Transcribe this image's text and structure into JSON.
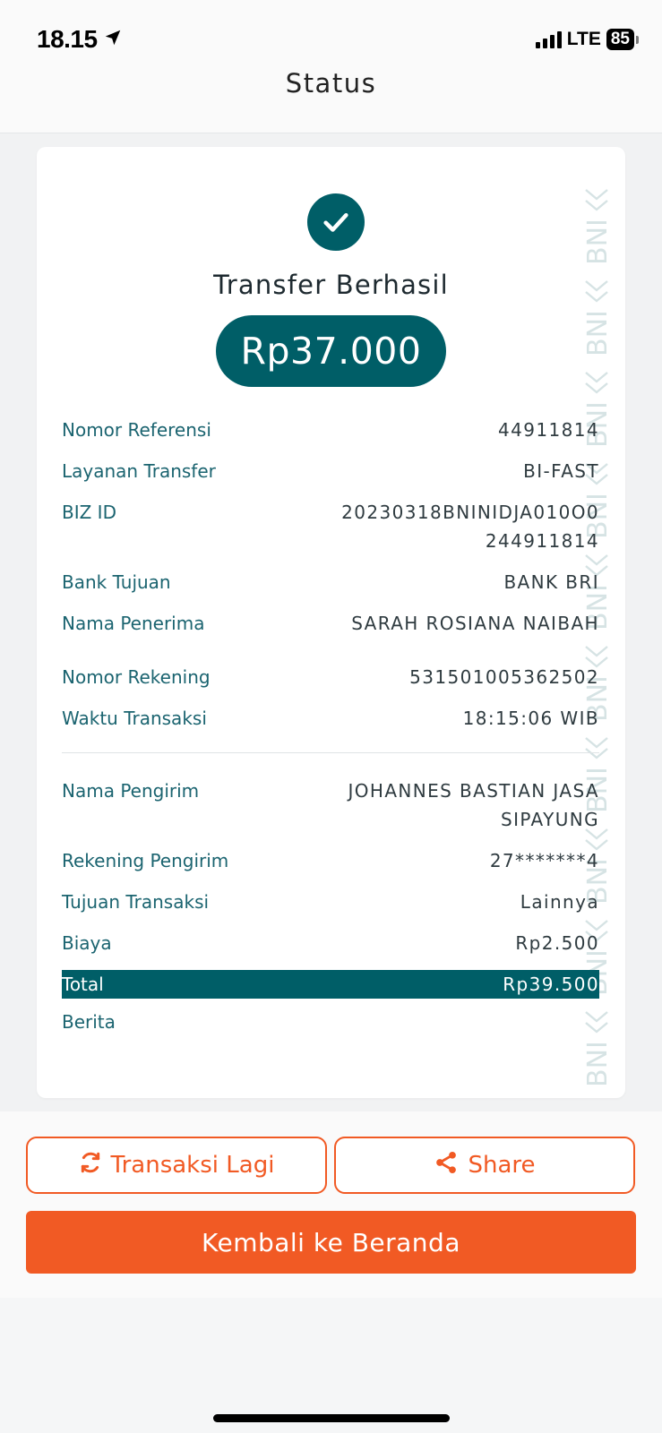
{
  "status_bar": {
    "time": "18.15",
    "network": "LTE",
    "battery": "85"
  },
  "header": {
    "title": "Status"
  },
  "receipt": {
    "title": "Transfer Berhasil",
    "amount": "Rp37.000",
    "watermark_text": "BNI",
    "rows": [
      {
        "label": "Nomor Referensi",
        "value": "44911814"
      },
      {
        "label": "Layanan Transfer",
        "value": "BI-FAST"
      },
      {
        "label": "BIZ ID",
        "value": "20230318BNINIDJA010O0 244911814"
      },
      {
        "label": "Bank Tujuan",
        "value": "BANK BRI"
      },
      {
        "label": "Nama Penerima",
        "value": "SARAH ROSIANA NAIBAH"
      },
      {
        "label": "Nomor Rekening",
        "value": "531501005362502"
      },
      {
        "label": "Waktu Transaksi",
        "value": "18:15:06 WIB"
      }
    ],
    "sender_rows": [
      {
        "label": "Nama Pengirim",
        "value": "JOHANNES BASTIAN JASA SIPAYUNG"
      },
      {
        "label": "Rekening Pengirim",
        "value": "27*******4"
      },
      {
        "label": "Tujuan Transaksi",
        "value": "Lainnya"
      },
      {
        "label": "Biaya",
        "value": "Rp2.500"
      }
    ],
    "total": {
      "label": "Total",
      "value": "Rp39.500"
    },
    "berita": {
      "label": "Berita",
      "value": ""
    }
  },
  "actions": {
    "repeat_label": "Transaksi Lagi",
    "share_label": "Share",
    "home_label": "Kembali ke Beranda"
  },
  "colors": {
    "primary_teal": "#005e67",
    "accent_orange": "#f15a24"
  }
}
